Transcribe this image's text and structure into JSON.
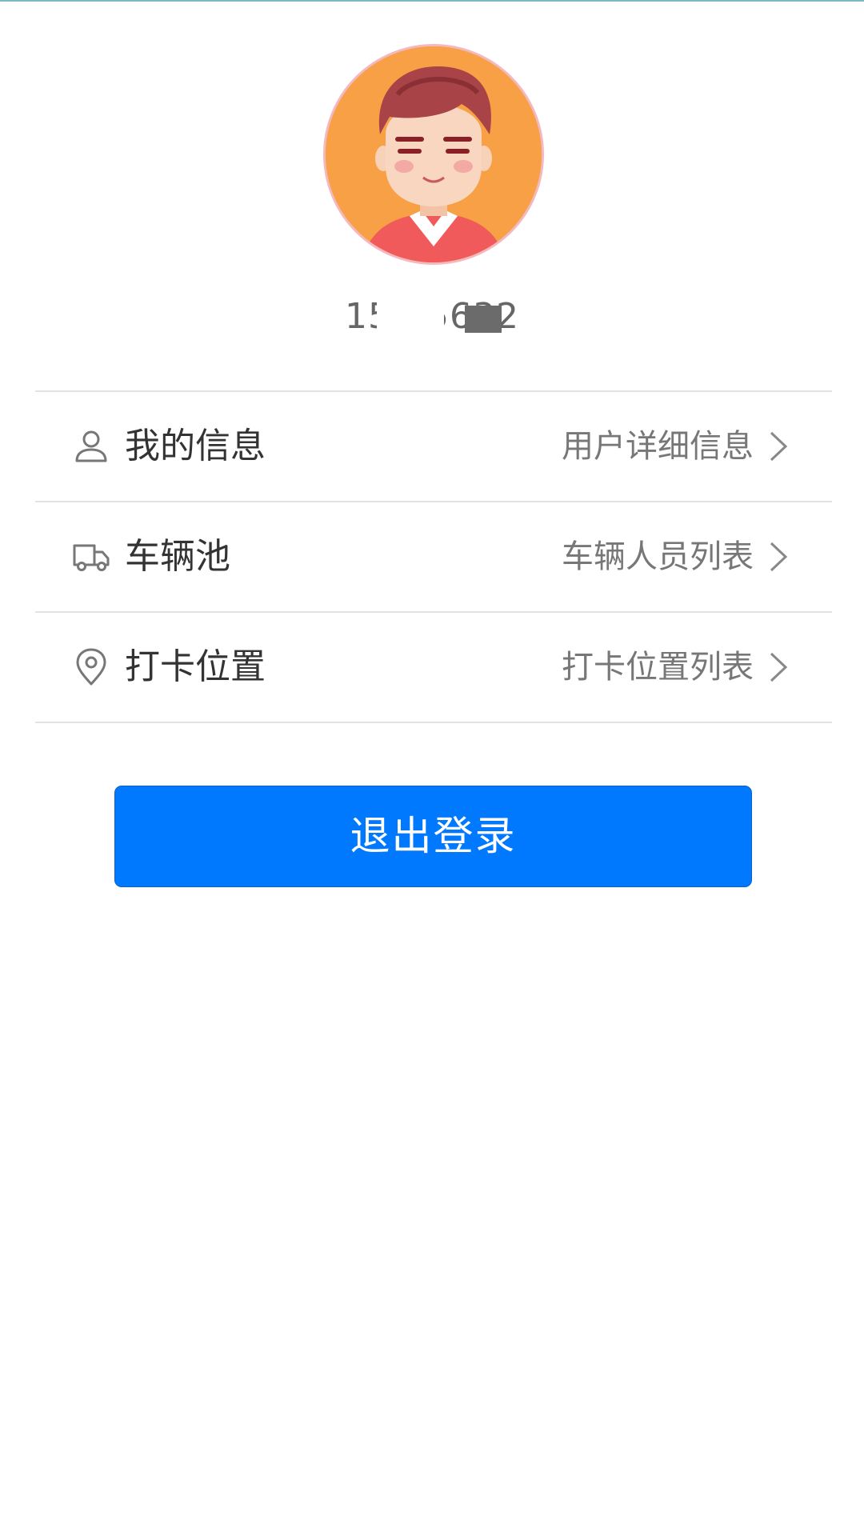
{
  "profile": {
    "phone": "159        5632",
    "avatar_icon": "user-avatar-cartoon"
  },
  "menu": [
    {
      "icon": "user-icon",
      "label": "我的信息",
      "detail": "用户详细信息"
    },
    {
      "icon": "truck-icon",
      "label": "车辆池",
      "detail": "车辆人员列表"
    },
    {
      "icon": "location-pin-icon",
      "label": "打卡位置",
      "detail": "打卡位置列表"
    }
  ],
  "logout_label": "退出登录",
  "colors": {
    "accent": "#0179ff",
    "avatar_bg": "#f7a045"
  }
}
